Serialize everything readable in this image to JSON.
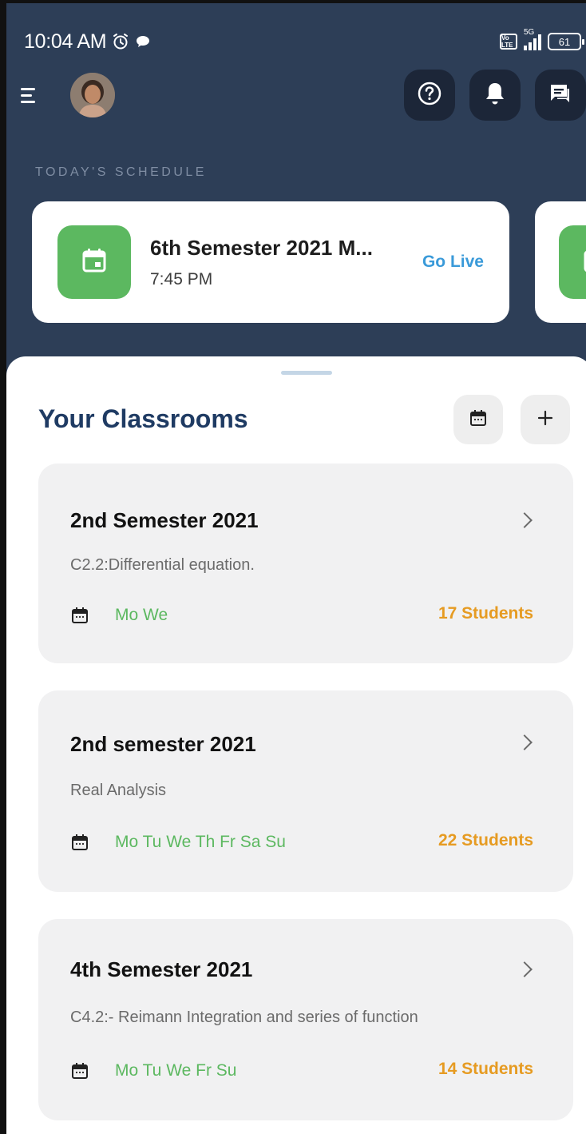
{
  "status_bar": {
    "time": "10:04 AM",
    "signal_label": "5G",
    "volte_label": "Vo LTE",
    "battery": "61"
  },
  "colors": {
    "header_bg": "#2d3e57",
    "accent_green": "#5cb860",
    "go_live_blue": "#3a9ad9",
    "title_navy": "#1f3b63",
    "students_orange": "#e69b22",
    "card_bg": "#f1f1f2"
  },
  "topbar": {
    "icons": [
      "menu-icon",
      "avatar",
      "help-icon",
      "bell-icon",
      "chat-icon"
    ]
  },
  "schedule": {
    "label": "TODAY'S SCHEDULE",
    "items": [
      {
        "title": "6th Semester 2021 M...",
        "time": "7:45 PM",
        "action": "Go Live"
      }
    ]
  },
  "classrooms": {
    "title": "Your Classrooms",
    "items": [
      {
        "name": "2nd Semester 2021",
        "subject": "C2.2:Differential equation.",
        "days": "Mo We",
        "students": "17 Students"
      },
      {
        "name": "2nd semester 2021",
        "subject": "Real Analysis",
        "days": "Mo Tu We Th Fr Sa Su",
        "students": "22 Students"
      },
      {
        "name": "4th Semester 2021",
        "subject": "C4.2:- Reimann Integration and series of function",
        "days": "Mo Tu We Fr Su",
        "students": "14 Students"
      }
    ]
  }
}
